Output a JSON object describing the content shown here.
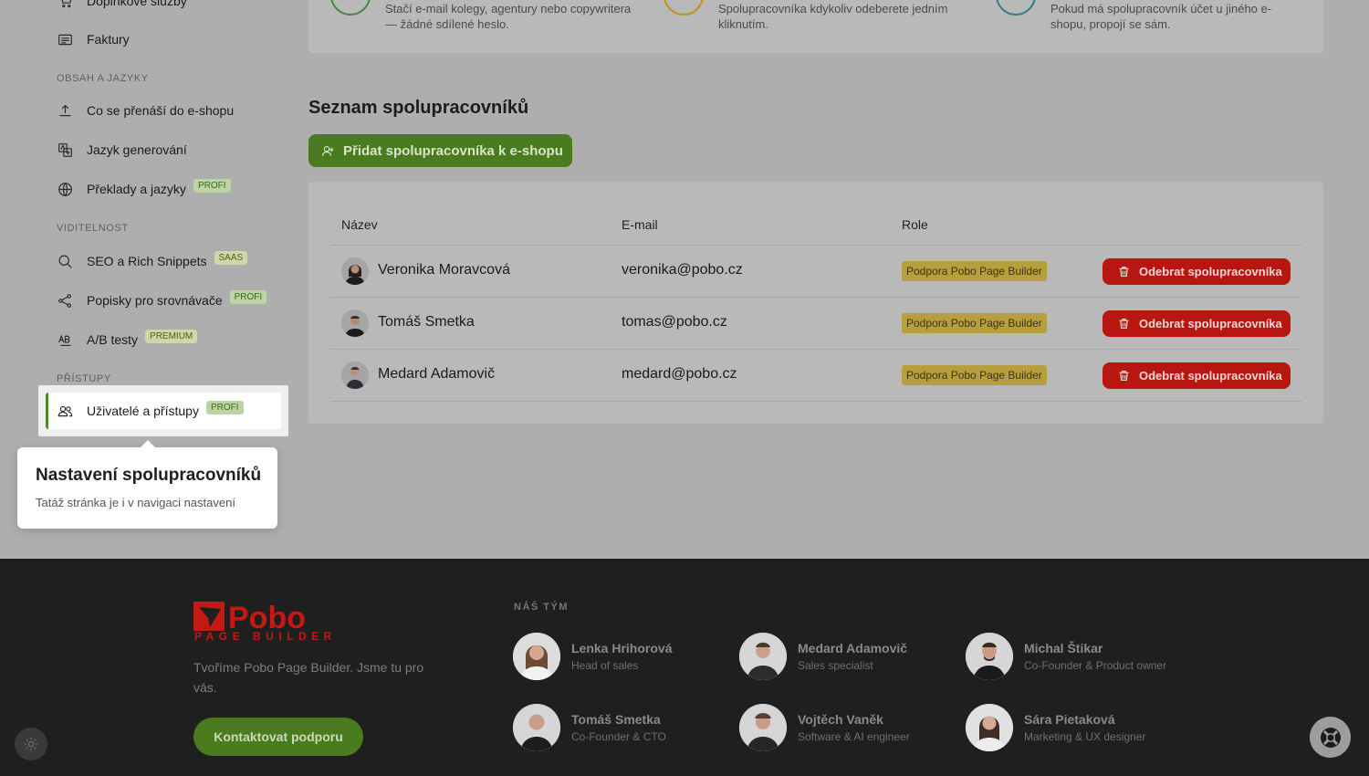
{
  "sidebar": {
    "items_top": [
      {
        "label": "Doplňkové služby",
        "icon": "cart-icon"
      },
      {
        "label": "Faktury",
        "icon": "invoice-icon"
      }
    ],
    "sections": [
      {
        "title": "Obsah a jazyky",
        "items": [
          {
            "label": "Co se přenáší do e-shopu",
            "icon": "upload-icon",
            "badge": ""
          },
          {
            "label": "Jazyk generování",
            "icon": "language-icon",
            "badge": ""
          },
          {
            "label": "Překlady a jazyky",
            "icon": "globe-icon",
            "badge": "PROFI"
          }
        ]
      },
      {
        "title": "Viditelnost",
        "items": [
          {
            "label": "SEO a Rich Snippets",
            "icon": "search-icon",
            "badge": "SAAS"
          },
          {
            "label": "Popisky pro srovnávače",
            "icon": "share-icon",
            "badge": "PROFI"
          },
          {
            "label": "A/B testy",
            "icon": "ab-test-icon",
            "badge": "PREMIUM"
          }
        ]
      },
      {
        "title": "Přístupy",
        "items": [
          {
            "label": "Uživatelé a přístupy",
            "icon": "users-icon",
            "badge": "PROFI"
          }
        ]
      }
    ]
  },
  "tooltip": {
    "title": "Nastavení spolupracovníků",
    "text": "Tatáž stránka je i v navigaci nastavení"
  },
  "features": [
    {
      "text1": "Stačí e-mail kolegy, agentury nebo copywritera",
      "text2": "— žádné sdílené heslo.",
      "color": "#3f8a3f"
    },
    {
      "text1": "Spolupracovníka kdykoliv odeberete jedním",
      "text2": "kliknutím.",
      "color": "#b8960f"
    },
    {
      "text1": "Pokud má spolupracovník účet u jiného e-",
      "text2": "shopu, propojí se sám.",
      "color": "#2f7b8c"
    }
  ],
  "collaborators": {
    "title": "Seznam spolupracovníků",
    "add_label": "Přidat spolupracovníka k e-shopu",
    "columns": {
      "name": "Název",
      "email": "E-mail",
      "role": "Role"
    },
    "remove_label": "Odebrat spolupracovníka",
    "rows": [
      {
        "name": "Veronika Moravcová",
        "email": "veronika@pobo.cz",
        "role": "Podpora Pobo Page Builder"
      },
      {
        "name": "Tomáš Smetka",
        "email": "tomas@pobo.cz",
        "role": "Podpora Pobo Page Builder"
      },
      {
        "name": "Medard Adamovič",
        "email": "medard@pobo.cz",
        "role": "Podpora Pobo Page Builder"
      }
    ]
  },
  "footer": {
    "logo_main": "Pobo",
    "logo_sub": "PAGE BUILDER",
    "tagline": "Tvoříme Pobo Page Builder. Jsme tu pro vás.",
    "contact_label": "Kontaktovat podporu",
    "team_heading": "NÁŠ TÝM",
    "team": [
      {
        "name": "Lenka Hrihorová",
        "role": "Head of sales"
      },
      {
        "name": "Medard Adamovič",
        "role": "Sales specialist"
      },
      {
        "name": "Michal Štikar",
        "role": "Co-Founder & Product owner"
      },
      {
        "name": "Tomáš Smetka",
        "role": "Co-Founder & CTO"
      },
      {
        "name": "Vojtěch Vaněk",
        "role": "Software & AI engineer"
      },
      {
        "name": "Sára Pietaková",
        "role": "Marketing & UX designer"
      }
    ]
  },
  "colors": {
    "accent": "#4a7b1f",
    "danger": "#b71710",
    "role_badge": "#b89e3c",
    "footer_bg": "#1f1f1f"
  }
}
